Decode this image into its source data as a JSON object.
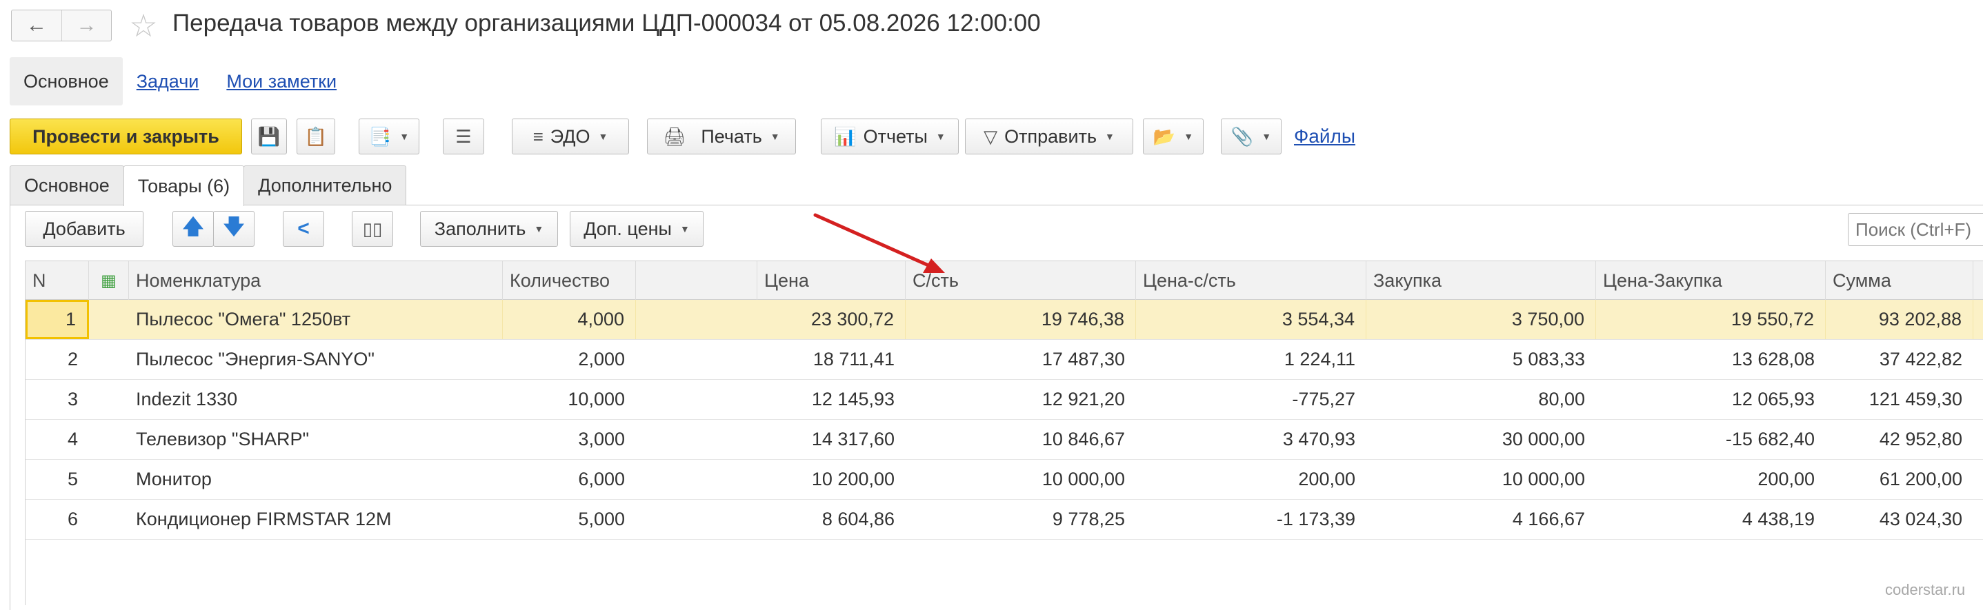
{
  "window": {
    "title": "Передача товаров между организациями ЦДП-000034 от 05.08.2026 12:00:00"
  },
  "sections": {
    "main": "Основное",
    "tasks": "Задачи",
    "notes": "Мои заметки"
  },
  "toolbar": {
    "post_close": "Провести и закрыть",
    "edo": "ЭДО",
    "print": "Печать",
    "reports": "Отчеты",
    "send": "Отправить",
    "files": "Файлы"
  },
  "tabs": [
    {
      "label": "Основное"
    },
    {
      "label": "Товары (6)"
    },
    {
      "label": "Дополнительно"
    }
  ],
  "table_toolbar": {
    "add": "Добавить",
    "fill": "Заполнить",
    "extra_prices": "Доп. цены",
    "search_placeholder": "Поиск (Ctrl+F)"
  },
  "table": {
    "headers": {
      "n": "N",
      "name": "Номенклатура",
      "qty": "Количество",
      "price": "Цена",
      "cost": "С/сть",
      "price_cost": "Цена-с/сть",
      "purchase": "Закупка",
      "price_purchase": "Цена-Закупка",
      "sum": "Сумма"
    },
    "rows": [
      {
        "n": "1",
        "name": "Пылесос \"Омега\" 1250вт",
        "qty": "4,000",
        "price": "23 300,72",
        "cost": "19 746,38",
        "price_cost": "3 554,34",
        "purchase": "3 750,00",
        "price_purchase": "19 550,72",
        "sum": "93 202,88"
      },
      {
        "n": "2",
        "name": "Пылесос \"Энергия-SANYO\"",
        "qty": "2,000",
        "price": "18 711,41",
        "cost": "17 487,30",
        "price_cost": "1 224,11",
        "purchase": "5 083,33",
        "price_purchase": "13 628,08",
        "sum": "37 422,82"
      },
      {
        "n": "3",
        "name": "Indezit 1330",
        "qty": "10,000",
        "price": "12 145,93",
        "cost": "12 921,20",
        "price_cost": "-775,27",
        "purchase": "80,00",
        "price_purchase": "12 065,93",
        "sum": "121 459,30"
      },
      {
        "n": "4",
        "name": "Телевизор \"SHARP\"",
        "qty": "3,000",
        "price": "14 317,60",
        "cost": "10 846,67",
        "price_cost": "3 470,93",
        "purchase": "30 000,00",
        "price_purchase": "-15 682,40",
        "sum": "42 952,80"
      },
      {
        "n": "5",
        "name": "Монитор",
        "qty": "6,000",
        "price": "10 200,00",
        "cost": "10 000,00",
        "price_cost": "200,00",
        "purchase": "10 000,00",
        "price_purchase": "200,00",
        "sum": "61 200,00"
      },
      {
        "n": "6",
        "name": "Кондиционер FIRMSTAR 12M",
        "qty": "5,000",
        "price": "8 604,86",
        "cost": "9 778,25",
        "price_cost": "-1 173,39",
        "purchase": "4 166,67",
        "price_purchase": "4 438,19",
        "sum": "43 024,30"
      }
    ]
  },
  "watermark": "coderstar.ru",
  "colors": {
    "accent_yellow": "#f5d21b",
    "selected_row": "#fbf1c6",
    "link_blue": "#1e4fb3",
    "annotation_arrow": "#d42020"
  }
}
